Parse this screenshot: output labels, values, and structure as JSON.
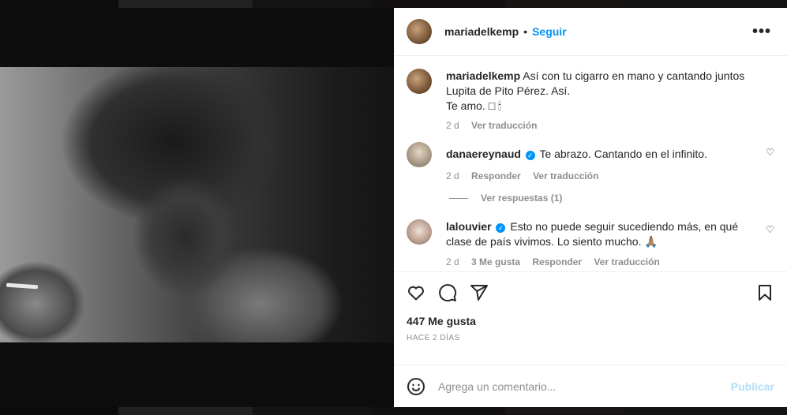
{
  "post": {
    "username": "mariadelkemp",
    "follow_label": "Seguir",
    "dot": "•",
    "more_icon": "more-horizontal-icon"
  },
  "caption": {
    "username": "mariadelkemp",
    "text": "Así con tu cigarro en mano y cantando juntos Lupita de Pito Pérez. Así.",
    "text2": "Te amo. □ 🕯",
    "time": "2 d",
    "translate": "Ver traducción"
  },
  "comments": [
    {
      "username": "danaereynaud",
      "verified": true,
      "text": "Te abrazo. Cantando en el infinito.",
      "time": "2 d",
      "reply": "Responder",
      "translate": "Ver traducción",
      "view_replies": "Ver respuestas (1)"
    },
    {
      "username": "lalouvier",
      "verified": true,
      "text": "Esto no puede seguir sucediendo más, en qué clase de país vivimos. Lo siento mucho. 🙏🏽",
      "time": "2 d",
      "likes": "3 Me gusta",
      "reply": "Responder",
      "translate": "Ver traducción"
    }
  ],
  "stats": {
    "likes": "447 Me gusta",
    "ago": "HACE 2 DÍAS"
  },
  "composer": {
    "placeholder": "Agrega un comentario...",
    "publish": "Publicar"
  },
  "colors": {
    "accent": "#0095f6",
    "muted": "#8e8e8e",
    "publish_disabled": "#b2dffc"
  }
}
